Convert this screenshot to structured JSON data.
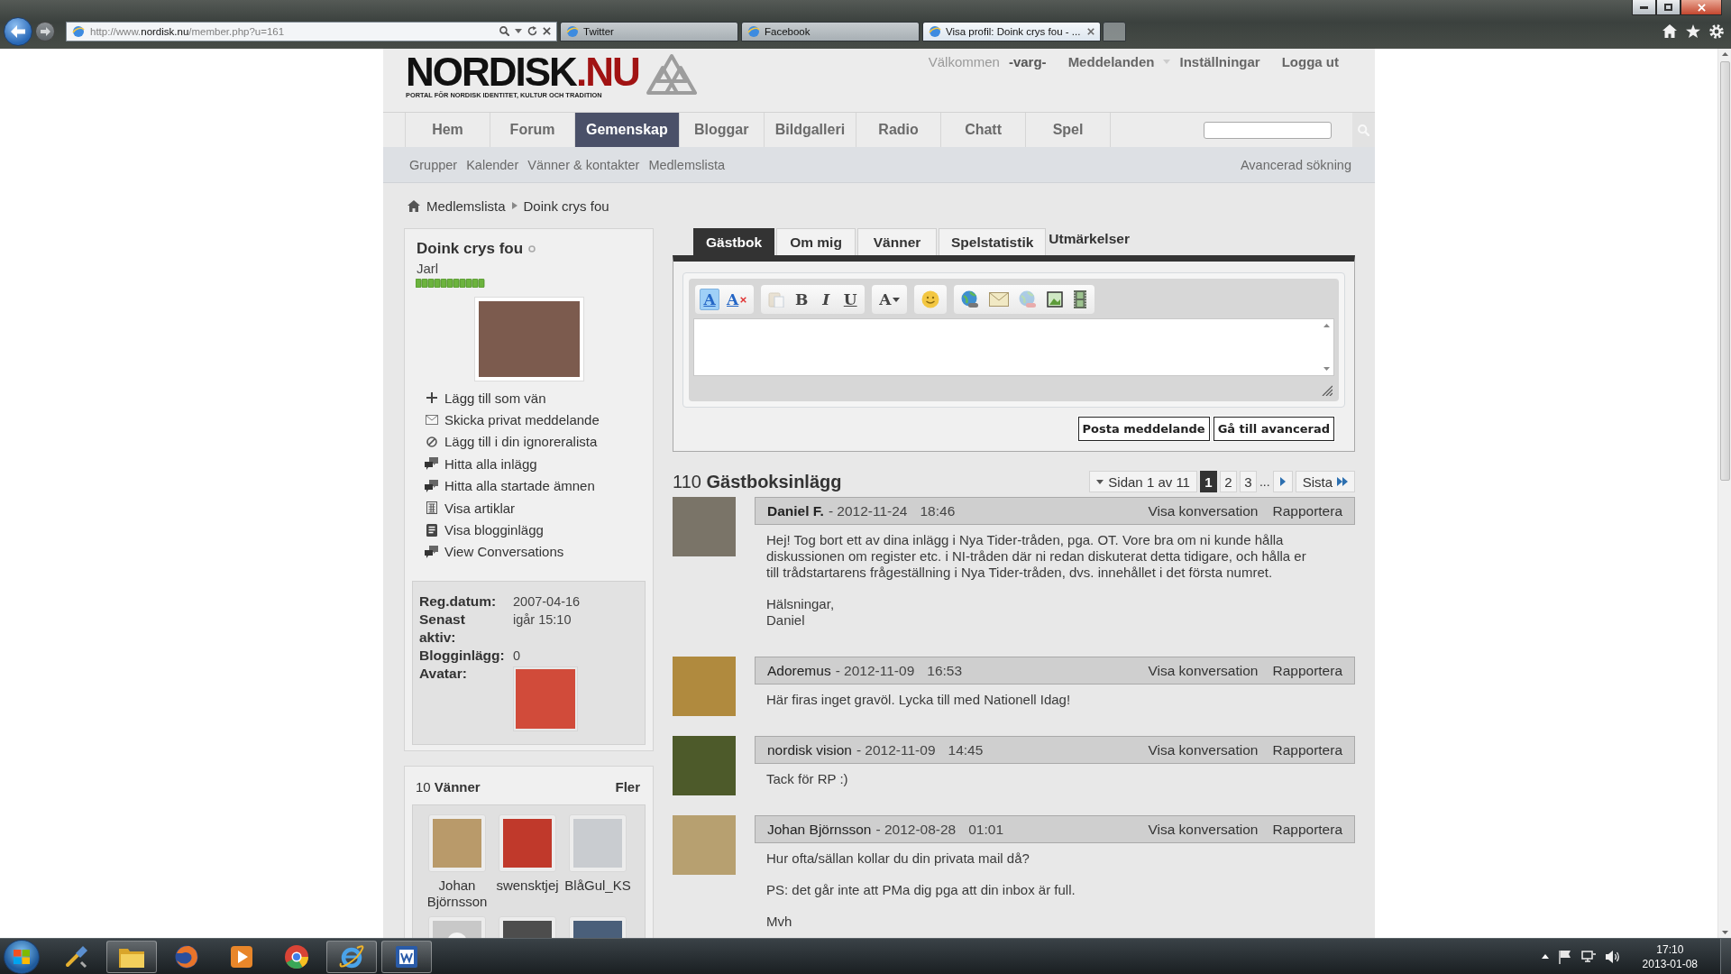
{
  "browser": {
    "address": "http://www.**nordisk.nu**/member.php?u=161",
    "tabs": [
      {
        "title": "Twitter",
        "selected": false
      },
      {
        "title": "Facebook",
        "selected": false
      },
      {
        "title": "Visa profil: Doink crys fou - ...",
        "selected": true
      }
    ]
  },
  "header": {
    "logo": {
      "name": "NORDISK",
      "suffix": ".NU",
      "tagline": "PORTAL FÖR NORDISK IDENTITET, KULTUR OCH TRADITION"
    },
    "welcome": "Välkommen",
    "username": "-varg-",
    "links": [
      {
        "label": "Meddelanden",
        "dropdown": true
      },
      {
        "label": "Inställningar",
        "dropdown": false
      },
      {
        "label": "Logga ut",
        "dropdown": false
      }
    ]
  },
  "nav": [
    {
      "label": "Hem",
      "selected": false
    },
    {
      "label": "Forum",
      "selected": false
    },
    {
      "label": "Gemenskap",
      "selected": true
    },
    {
      "label": "Bloggar",
      "selected": false
    },
    {
      "label": "Bildgalleri",
      "selected": false
    },
    {
      "label": "Radio",
      "selected": false
    },
    {
      "label": "Chatt",
      "selected": false
    },
    {
      "label": "Spel",
      "selected": false
    }
  ],
  "subnav": {
    "links": [
      "Grupper",
      "Kalender",
      "Vänner & kontakter",
      "Medlemslista"
    ],
    "advanced_search": "Avancerad sökning"
  },
  "breadcrumb": [
    "Medlemslista",
    "Doink crys fou"
  ],
  "profile": {
    "name": "Doink crys fou",
    "online": false,
    "rank": "Jarl",
    "actions": [
      {
        "kind": "plus",
        "label": "Lägg till som vän"
      },
      {
        "kind": "envelope",
        "label": "Skicka privat meddelande"
      },
      {
        "kind": "ban",
        "label": "Lägg till i din ignoreralista"
      },
      {
        "kind": "chat",
        "label": "Hitta alla inlägg"
      },
      {
        "kind": "chat",
        "label": "Hitta alla startade ämnen"
      },
      {
        "kind": "grid",
        "label": "Visa artiklar"
      },
      {
        "kind": "document",
        "label": "Visa blogginlägg"
      },
      {
        "kind": "chat",
        "label": "View Conversations"
      }
    ],
    "stats": [
      {
        "kind": "text",
        "label": "Reg.datum:",
        "value": "2007-04-16"
      },
      {
        "kind": "text",
        "label": "Senast aktiv:",
        "value": "igår 15:10"
      },
      {
        "kind": "text",
        "label": "Blogginlägg:",
        "value": "0"
      },
      {
        "kind": "image",
        "label": "Avatar:"
      }
    ]
  },
  "friends": {
    "heading": "10 **Vänner**",
    "more": "Fler",
    "items": [
      {
        "kind": "photo",
        "name": "Johan Björnsson"
      },
      {
        "kind": "photo",
        "name": "swensktjej"
      },
      {
        "kind": "photo",
        "name": "BlåGul_KS"
      },
      {
        "kind": "default"
      },
      {
        "kind": "photo"
      },
      {
        "kind": "photo"
      }
    ]
  },
  "tabs": [
    {
      "label": "Gästbok",
      "selected": true,
      "kind": "boxed"
    },
    {
      "label": "Om mig",
      "selected": false,
      "kind": "boxed"
    },
    {
      "label": "Vänner",
      "selected": false,
      "kind": "boxed"
    },
    {
      "label": "Spelstatistik",
      "selected": false,
      "kind": "boxed"
    },
    {
      "label": "Utmärkelser",
      "selected": false,
      "kind": "plain"
    }
  ],
  "editor": {
    "toolbar": [
      {
        "buttons": [
          {
            "kind": "mode",
            "glyph": "A",
            "on": true,
            "disabled": false
          },
          {
            "kind": "clear",
            "glyph": "A",
            "on": false,
            "disabled": false
          }
        ]
      },
      {
        "buttons": [
          {
            "kind": "paste",
            "on": false,
            "disabled": true
          },
          {
            "kind": "bold",
            "glyph": "B",
            "on": false,
            "disabled": false
          },
          {
            "kind": "italic",
            "glyph": "I",
            "on": false,
            "disabled": false
          },
          {
            "kind": "underline",
            "glyph": "U",
            "on": false,
            "disabled": false
          }
        ]
      },
      {
        "buttons": [
          {
            "kind": "font",
            "glyph": "A",
            "on": false,
            "disabled": false
          }
        ]
      },
      {
        "buttons": [
          {
            "kind": "smiley",
            "on": false,
            "disabled": false
          }
        ]
      },
      {
        "buttons": [
          {
            "kind": "link",
            "on": false,
            "disabled": false
          },
          {
            "kind": "email",
            "on": false,
            "disabled": false
          },
          {
            "kind": "unlink",
            "on": false,
            "disabled": true
          },
          {
            "kind": "image",
            "on": false,
            "disabled": false
          },
          {
            "kind": "video",
            "on": false,
            "disabled": false
          }
        ]
      }
    ],
    "buttons": [
      "Posta meddelande",
      "Gå till avancerad"
    ]
  },
  "guestbook": {
    "heading": "110 **Gästboksinlägg**",
    "pagination": {
      "summary": "Sidan 1 av 11",
      "pages": [
        {
          "label": "1",
          "selected": true
        },
        {
          "label": "2",
          "selected": false
        },
        {
          "label": "3",
          "selected": false
        }
      ],
      "ellipsis": "...",
      "last": "Sista"
    },
    "entries": [
      {
        "author": "Daniel F.",
        "author_bold": true,
        "date": "- 2012-11-24",
        "time": "18:46",
        "actions": [
          "Visa konversation",
          "Rapportera"
        ],
        "paragraphs": [
          [
            "Hej! Tog bort ett av dina inlägg i Nya Tider-tråden, pga. OT. Vore bra om ni kunde hålla diskussionen om register etc. i NI-tråden där ni redan diskuterat detta tidigare, och hålla er till trådstartarens frågeställning i Nya Tider-tråden, dvs. innehållet i det första numret."
          ],
          [
            "Hälsningar,",
            "Daniel"
          ]
        ]
      },
      {
        "author": "Adoremus",
        "author_bold": false,
        "date": "- 2012-11-09",
        "time": "16:53",
        "actions": [
          "Visa konversation",
          "Rapportera"
        ],
        "paragraphs": [
          [
            "Här firas inget gravöl. Lycka till med Nationell Idag!"
          ]
        ]
      },
      {
        "author": "nordisk vision",
        "author_bold": false,
        "date": "- 2012-11-09",
        "time": "14:45",
        "actions": [
          "Visa konversation",
          "Rapportera"
        ],
        "paragraphs": [
          [
            "Tack för RP :)"
          ]
        ]
      },
      {
        "author": "Johan Björnsson",
        "author_bold": false,
        "date": "- 2012-08-28",
        "time": "01:01",
        "actions": [
          "Visa konversation",
          "Rapportera"
        ],
        "paragraphs": [
          [
            "Hur ofta/sällan kollar du din privata mail då?"
          ],
          [
            "PS: det går inte att PMa dig pga att din inbox är full."
          ],
          [
            "Mvh"
          ]
        ]
      }
    ]
  },
  "taskbar": {
    "apps": [
      {
        "kind": "tools",
        "running": false
      },
      {
        "kind": "folder",
        "running": true
      },
      {
        "kind": "fox",
        "running": false
      },
      {
        "kind": "player",
        "running": false
      },
      {
        "kind": "aperture",
        "running": false
      },
      {
        "kind": "orbit",
        "running": true
      },
      {
        "kind": "word",
        "running": true
      }
    ],
    "clock": {
      "time": "17:10",
      "date": "2013-01-08"
    }
  }
}
